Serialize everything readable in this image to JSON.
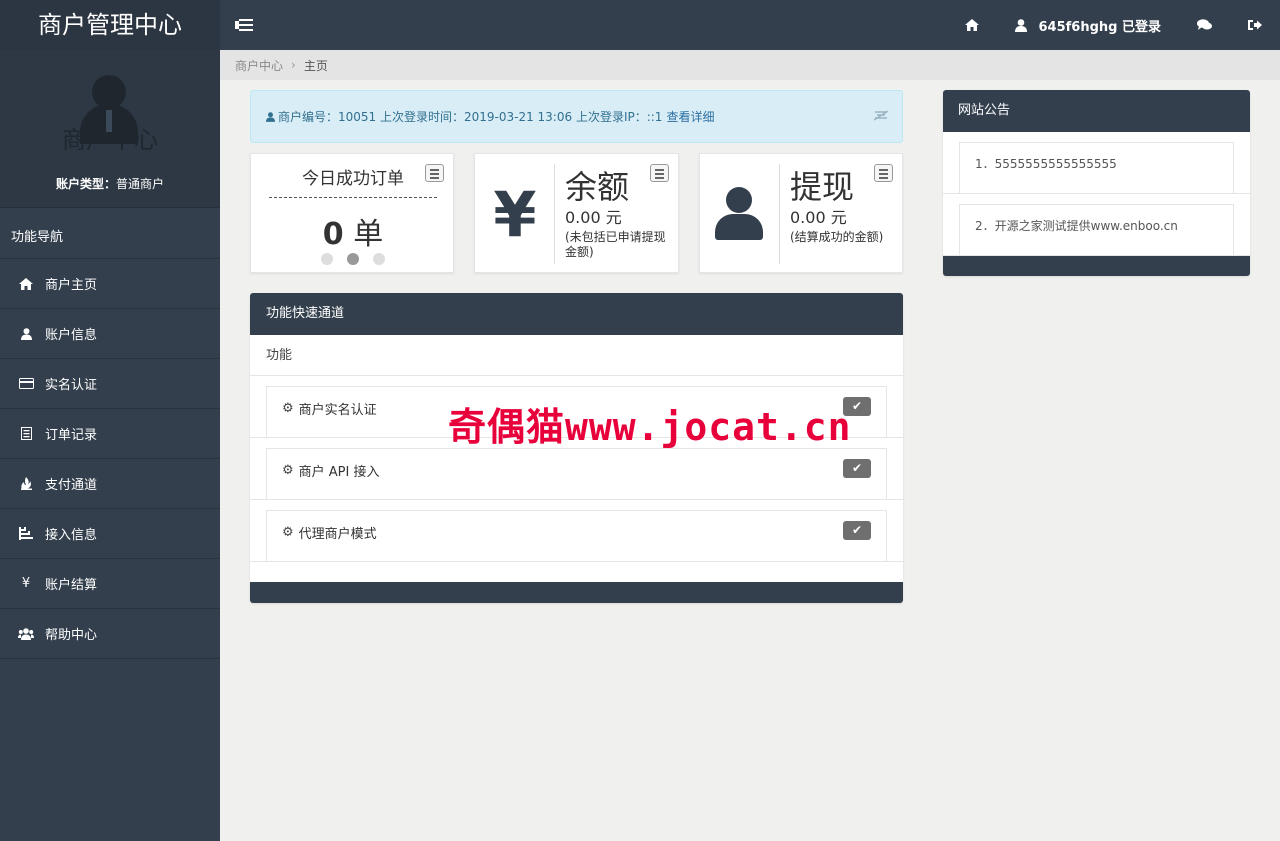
{
  "app": {
    "title": "商户管理中心"
  },
  "topbar": {
    "username": "645f6hghg 已登录"
  },
  "sidebar": {
    "profile_label": "商户中心",
    "account_type_label": "账户类型：",
    "account_type_value": "普通商户",
    "nav_title": "功能导航",
    "items": [
      {
        "label": "商户主页",
        "icon": "home-icon"
      },
      {
        "label": "账户信息",
        "icon": "user-icon"
      },
      {
        "label": "实名认证",
        "icon": "credit-card-icon"
      },
      {
        "label": "订单记录",
        "icon": "list-icon"
      },
      {
        "label": "支付通道",
        "icon": "fire-icon"
      },
      {
        "label": "接入信息",
        "icon": "tree-icon"
      },
      {
        "label": "账户结算",
        "icon": "yen-icon"
      },
      {
        "label": "帮助中心",
        "icon": "users-icon"
      }
    ]
  },
  "breadcrumb": {
    "parent": "商户中心",
    "current": "主页"
  },
  "infobar": {
    "text": "商户编号：10051 上次登录时间：2019-03-21 13:06 上次登录IP：::1",
    "link": "查看详细"
  },
  "stats": {
    "orders": {
      "title": "今日成功订单",
      "count": "0",
      "unit": "单"
    },
    "balance": {
      "glyph": "¥",
      "title": "余额",
      "amount": "0.00 元",
      "note": "(未包括已申请提现金额)"
    },
    "withdraw": {
      "title": "提现",
      "amount": "0.00 元",
      "note": "(结算成功的金额)"
    }
  },
  "functions": {
    "title": "功能快速通道",
    "subtitle": "功能",
    "items": [
      {
        "label": "商户实名认证"
      },
      {
        "label": "商户 API 接入"
      },
      {
        "label": "代理商户模式"
      }
    ]
  },
  "notice": {
    "title": "网站公告",
    "items": [
      {
        "text": "1．5555555555555555"
      },
      {
        "text": "2．开源之家测试提供www.enboo.cn"
      }
    ]
  },
  "watermark": "奇偶猫www.jocat.cn",
  "colors": {
    "dark": "#333f4c",
    "info_bg": "#d9edf7",
    "watermark": "#e8003a"
  }
}
